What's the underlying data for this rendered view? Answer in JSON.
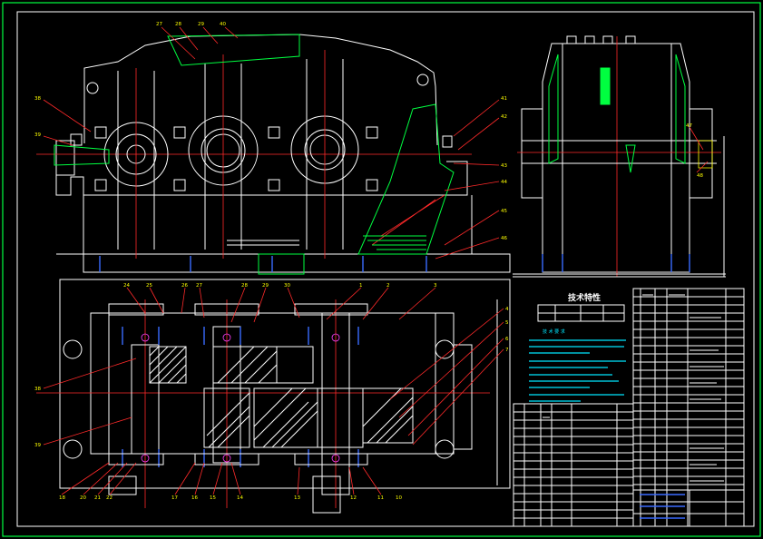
{
  "drawing": {
    "tech_title": "技术特性",
    "tech_req_title": "技 术 要 求",
    "callouts_top": [
      "27",
      "28",
      "29",
      "40",
      "41",
      "42",
      "43",
      "44",
      "45",
      "46",
      "47",
      "48"
    ],
    "callouts_left": [
      "38",
      "39"
    ],
    "callouts_plan_top": [
      "24",
      "25",
      "26",
      "27",
      "28",
      "29",
      "30",
      "1",
      "2",
      "3"
    ],
    "callouts_plan_right": [
      "4",
      "5",
      "6",
      "7"
    ],
    "callouts_plan_left": [
      "38",
      "39"
    ],
    "callouts_plan_bottom": [
      "18",
      "20",
      "21",
      "22",
      "17",
      "16",
      "15",
      "14",
      "13",
      "12",
      "11",
      "10"
    ]
  }
}
